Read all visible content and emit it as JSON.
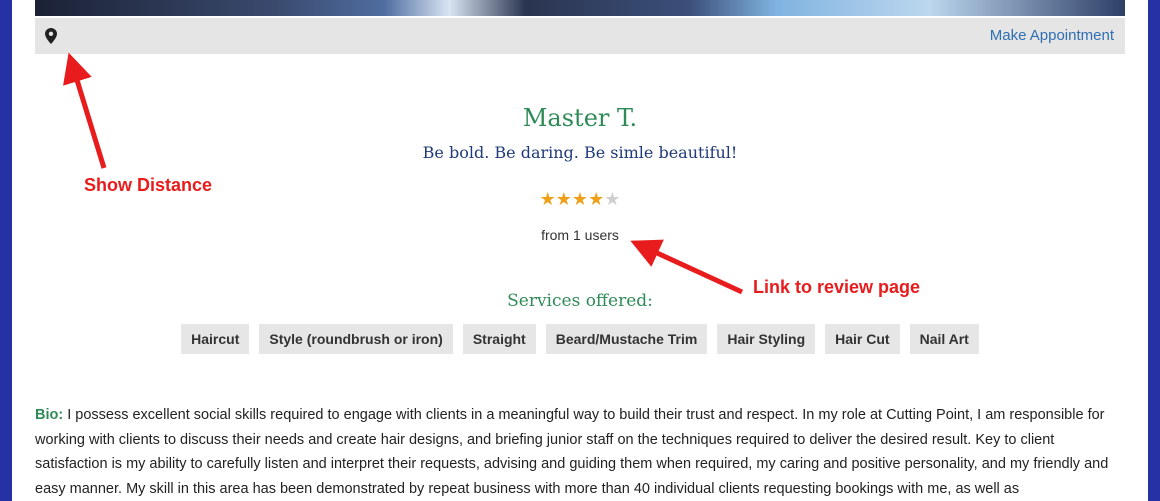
{
  "header": {
    "make_appointment_label": "Make Appointment",
    "location_icon": "map-pin-icon"
  },
  "profile": {
    "name": "Master T.",
    "tagline": "Be bold. Be daring. Be simle beautiful!",
    "rating": {
      "stars_filled": 4,
      "stars_total": 5
    },
    "review_count_text": "from 1 users"
  },
  "services": {
    "title": "Services offered:",
    "items": [
      "Haircut",
      "Style (roundbrush or iron)",
      "Straight",
      "Beard/Mustache Trim",
      "Hair Styling",
      "Hair Cut",
      "Nail Art"
    ]
  },
  "bio": {
    "label": "Bio:",
    "text": "I possess excellent social skills required to engage with clients in a meaningful way to build their trust and respect. In my role at Cutting Point, I am responsible for working with clients to discuss their needs and create hair designs, and briefing junior staff on the techniques required to deliver the desired result. Key to client satisfaction is my ability to carefully listen and interpret their requests, advising and guiding them when required, my caring and positive personality, and my friendly and easy manner. My skill in this area has been demonstrated by repeat business with more than 40 individual clients requesting bookings with me, as well as"
  },
  "annotations": {
    "show_distance": "Show Distance",
    "link_to_review": "Link to review page"
  },
  "colors": {
    "frame": "#2631a3",
    "accent_green": "#2e8b57",
    "link_blue": "#2f6fb3",
    "star": "#f0a018",
    "annotation_red": "#e81c1c"
  }
}
